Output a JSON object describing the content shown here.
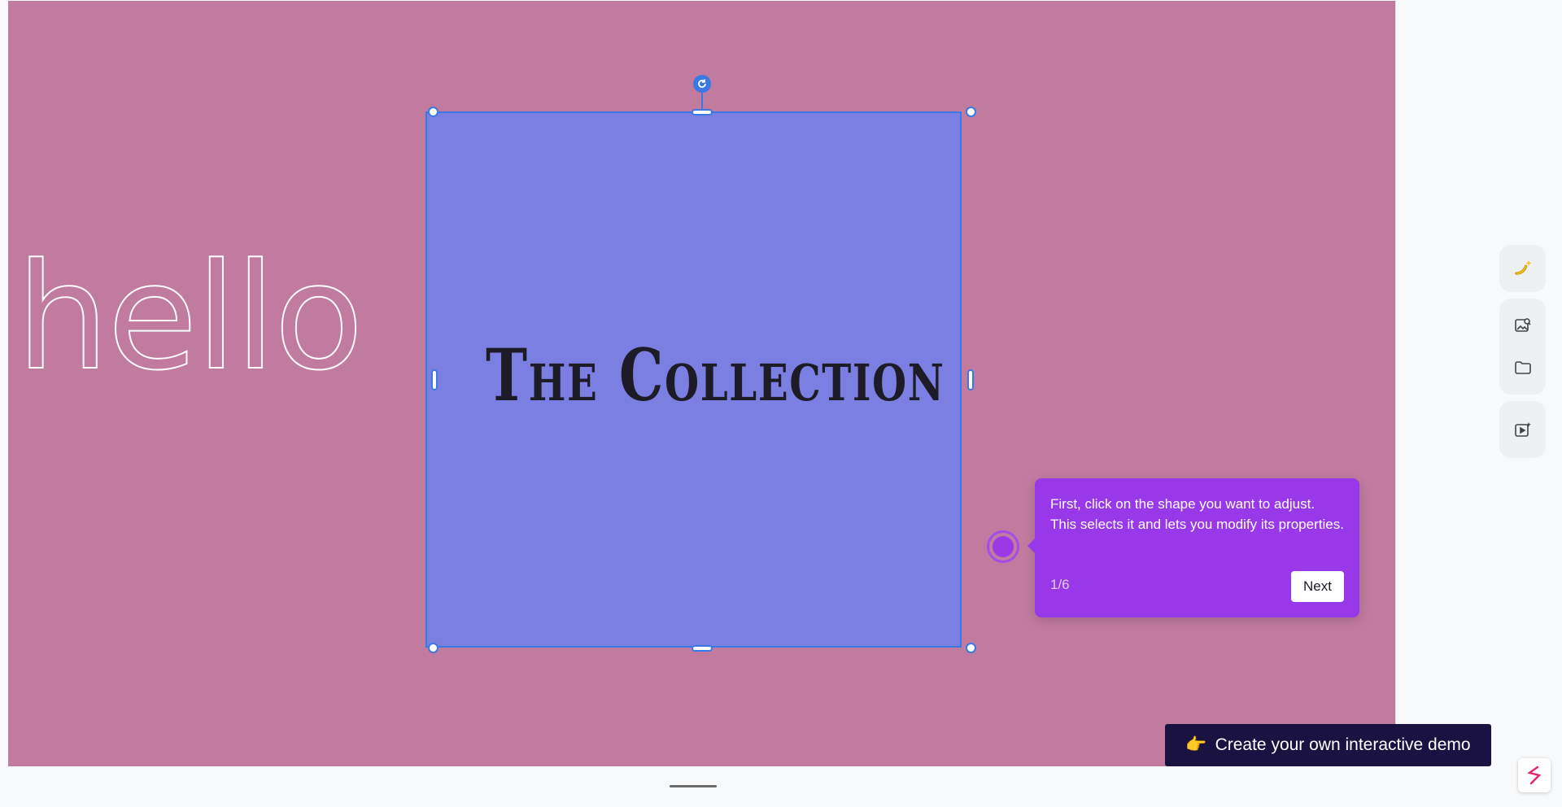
{
  "canvas": {
    "background_color": "#c17b9f",
    "hello_text": "hello",
    "shape": {
      "fill_color": "#7b7fe1",
      "text": "The Collection",
      "selection_color": "#3a78e6"
    }
  },
  "tour": {
    "tooltip_text": "First, click on the shape you want to adjust. This selects it and lets you modify its properties.",
    "step": "1/6",
    "next_label": "Next",
    "accent_color": "#9938e8"
  },
  "side_toolbar": {
    "items": [
      {
        "icon": "banana-sparkle-icon"
      },
      {
        "icon": "image-search-icon"
      },
      {
        "icon": "folder-icon"
      },
      {
        "icon": "video-sparkle-icon"
      }
    ]
  },
  "demo_cta": {
    "emoji": "👉",
    "label": "Create your own interactive demo"
  },
  "brand": {
    "icon": "storylane-logo-icon"
  }
}
